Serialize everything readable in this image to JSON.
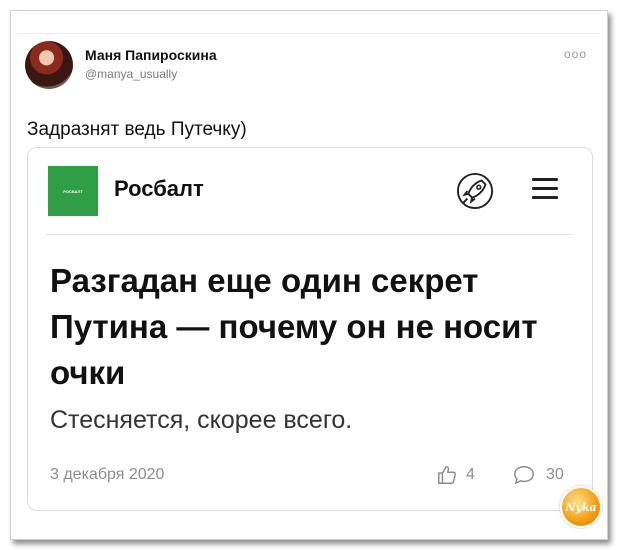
{
  "tweet": {
    "author_name": "Маня Папироскина",
    "author_handle": "@manya_usually",
    "more_icon": "more-dots-icon",
    "text": "Задразнят ведь Путечку)"
  },
  "card": {
    "logo_text": "РОСБАЛТ",
    "site_name": "Росбалт",
    "rocket_icon": "rocket-icon",
    "menu_icon": "hamburger-menu-icon",
    "headline": "Разгадан еще один секрет Путина — почему он не носит очки",
    "subtitle": "Стесняется, скорее всего.",
    "date": "3 декабря 2020",
    "likes": "4",
    "comments": "30",
    "accent_color": "#2f9e44"
  },
  "watermark": {
    "text": "Nyka"
  }
}
